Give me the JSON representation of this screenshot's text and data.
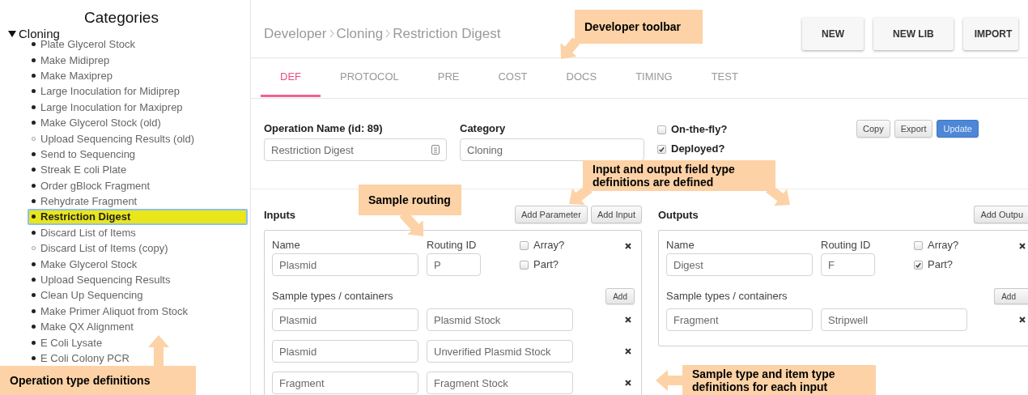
{
  "sidebar": {
    "title": "Categories",
    "category": {
      "label": "Cloning",
      "expanded": true,
      "items": [
        {
          "label": "Plate Glycerol Stock",
          "deployed": true,
          "selected": false
        },
        {
          "label": "Make Midiprep",
          "deployed": true,
          "selected": false
        },
        {
          "label": "Make Maxiprep",
          "deployed": true,
          "selected": false
        },
        {
          "label": "Large Inoculation for Midiprep",
          "deployed": true,
          "selected": false
        },
        {
          "label": "Large Inoculation for Maxiprep",
          "deployed": true,
          "selected": false
        },
        {
          "label": "Make Glycerol Stock (old)",
          "deployed": true,
          "selected": false
        },
        {
          "label": "Upload Sequencing Results (old)",
          "deployed": false,
          "selected": false
        },
        {
          "label": "Send to Sequencing",
          "deployed": true,
          "selected": false
        },
        {
          "label": "Streak E coli Plate",
          "deployed": true,
          "selected": false
        },
        {
          "label": "Order gBlock Fragment",
          "deployed": true,
          "selected": false
        },
        {
          "label": "Rehydrate Fragment",
          "deployed": true,
          "selected": false
        },
        {
          "label": "Restriction Digest",
          "deployed": true,
          "selected": true
        },
        {
          "label": "Discard List of Items",
          "deployed": true,
          "selected": false
        },
        {
          "label": "Discard List of Items (copy)",
          "deployed": false,
          "selected": false
        },
        {
          "label": "Make Glycerol Stock",
          "deployed": true,
          "selected": false
        },
        {
          "label": "Upload Sequencing Results",
          "deployed": true,
          "selected": false
        },
        {
          "label": "Clean Up Sequencing",
          "deployed": true,
          "selected": false
        },
        {
          "label": "Make Primer Aliquot from Stock",
          "deployed": true,
          "selected": false
        },
        {
          "label": "Make QX Alignment",
          "deployed": true,
          "selected": false
        },
        {
          "label": "E Coli Lysate",
          "deployed": true,
          "selected": false
        },
        {
          "label": "E Coli Colony PCR",
          "deployed": true,
          "selected": false
        }
      ]
    }
  },
  "breadcrumb": [
    "Developer",
    "Cloning",
    "Restriction Digest"
  ],
  "header_buttons": [
    "NEW",
    "NEW LIB",
    "IMPORT"
  ],
  "tabs": [
    {
      "label": "DEF",
      "selected": true
    },
    {
      "label": "PROTOCOL",
      "selected": false
    },
    {
      "label": "PRE",
      "selected": false
    },
    {
      "label": "COST",
      "selected": false
    },
    {
      "label": "DOCS",
      "selected": false
    },
    {
      "label": "TIMING",
      "selected": false
    },
    {
      "label": "TEST",
      "selected": false
    }
  ],
  "form": {
    "name_label": "Operation Name (id: 89)",
    "name_value": "Restriction Digest",
    "category_label": "Category",
    "category_value": "Cloning",
    "flags": [
      {
        "label": "On-the-fly?",
        "checked": false
      },
      {
        "label": "Deployed?",
        "checked": true
      }
    ],
    "actions": [
      {
        "label": "Copy",
        "kind": "default"
      },
      {
        "label": "Export",
        "kind": "default"
      },
      {
        "label": "Update",
        "kind": "primary"
      }
    ]
  },
  "inputs": {
    "title": "Inputs",
    "buttons": [
      "Add Parameter",
      "Add Input"
    ],
    "items": [
      {
        "name_label": "Name",
        "name": "Plasmid",
        "routing_label": "Routing ID",
        "routing": "P",
        "flags": [
          {
            "label": "Array?",
            "checked": false
          },
          {
            "label": "Part?",
            "checked": false
          }
        ],
        "types_label": "Sample types / containers",
        "add": "Add",
        "types": [
          {
            "sample": "Plasmid",
            "container": "Plasmid Stock"
          },
          {
            "sample": "Plasmid",
            "container": "Unverified Plasmid Stock"
          },
          {
            "sample": "Fragment",
            "container": "Fragment Stock"
          }
        ]
      }
    ]
  },
  "outputs": {
    "title": "Outputs",
    "buttons": [
      "Add Outpu"
    ],
    "items": [
      {
        "name_label": "Name",
        "name": "Digest",
        "routing_label": "Routing ID",
        "routing": "F",
        "flags": [
          {
            "label": "Array?",
            "checked": false
          },
          {
            "label": "Part?",
            "checked": true
          }
        ],
        "types_label": "Sample types / containers",
        "add": "Add",
        "types": [
          {
            "sample": "Fragment",
            "container": "Stripwell"
          }
        ]
      }
    ]
  },
  "callouts": [
    {
      "text": "Developer toolbar"
    },
    {
      "text": "Input and output field type definitions are defined"
    },
    {
      "text": "Sample routing"
    },
    {
      "text": "Operation type definitions"
    },
    {
      "text": "Sample type and item type definitions for each input"
    }
  ]
}
